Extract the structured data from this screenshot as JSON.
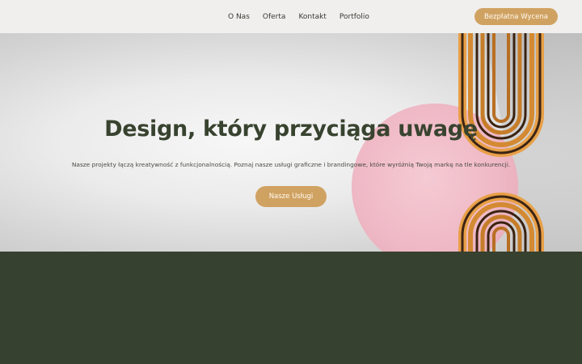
{
  "nav": {
    "links": [
      "O Nas",
      "Oferta",
      "Kontakt",
      "Portfolio"
    ],
    "cta_label": "Bezpłatna Wycena"
  },
  "hero": {
    "title": "Design, który przyciąga uwagę",
    "subtitle": "Nasze projekty łączą kreatywność z funkcjonalnością. Poznaj nasze usługi graficzne i brandingowe, które wyróżnią Twoją markę na tle konkurencji.",
    "button_label": "Nasze Usługi"
  },
  "colors": {
    "accent": "#d0a262",
    "dark_green": "#374130",
    "title_green": "#38432f",
    "nav_bg": "#f0efee",
    "pink": "#f1bfcb"
  }
}
